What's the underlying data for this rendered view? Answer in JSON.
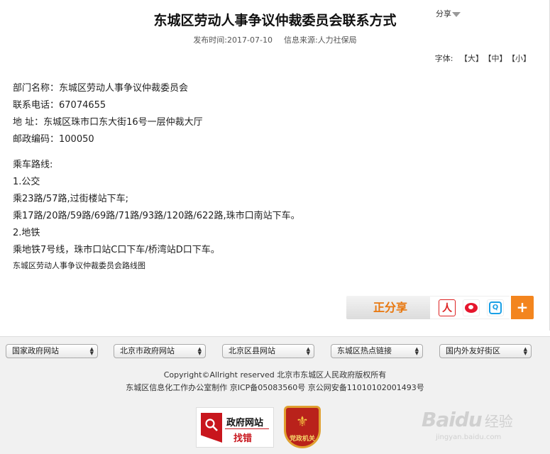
{
  "article": {
    "title": "东城区劳动人事争议仲裁委员会联系方式",
    "share_label": "分享",
    "publish_time": "发布时间:2017-07-10",
    "source": "信息来源:人力社保局",
    "font_size_label": "字体:",
    "font_sizes": [
      "【大】",
      "【中】",
      "【小】"
    ],
    "dept": "部门名称：东城区劳动人事争议仲裁委员会",
    "phone": "联系电话：67074655",
    "address": "地 址：东城区珠市口东大街16号一层仲裁大厅",
    "postcode": "邮政编码：100050",
    "route_title": "乘车路线:",
    "bus_title": "1.公交",
    "bus_line1": "乘23路/57路,过街楼站下车;",
    "bus_line2": "乘17路/20路/59路/69路/71路/93路/120路/622路,珠市口南站下车。",
    "subway_title": "2.地铁",
    "subway_line": "乘地铁7号线，珠市口站C口下车/桥湾站D口下车。",
    "map_caption": "东城区劳动人事争议仲裁委员会路线图"
  },
  "sharebar": {
    "label": "正分享",
    "buttons": [
      {
        "icon": "renren-icon",
        "glyph": "人"
      },
      {
        "icon": "weibo-icon"
      },
      {
        "icon": "qzone-icon",
        "glyph": "Q"
      }
    ],
    "more": "+",
    "colors": {
      "accent": "#f3851e",
      "label_text": "#e8770e"
    }
  },
  "footer": {
    "selects": [
      "国家政府网站",
      "北京市政府网站",
      "北京区县网站",
      "东城区热点链接",
      "国内外友好街区"
    ],
    "copyright": "Copyright©Allright reserved 北京市东城区人民政府版权所有",
    "icp": "东城区信息化工作办公室制作 京ICP备05083560号 京公网安备11010102001493号",
    "badge_gov_title": "政府网站",
    "badge_gov_sub": "找错",
    "badge_party_text": "党政机关"
  },
  "watermark": {
    "brand": "Baidu",
    "brand_cn": "经验",
    "url": "jingyan.baidu.com"
  }
}
